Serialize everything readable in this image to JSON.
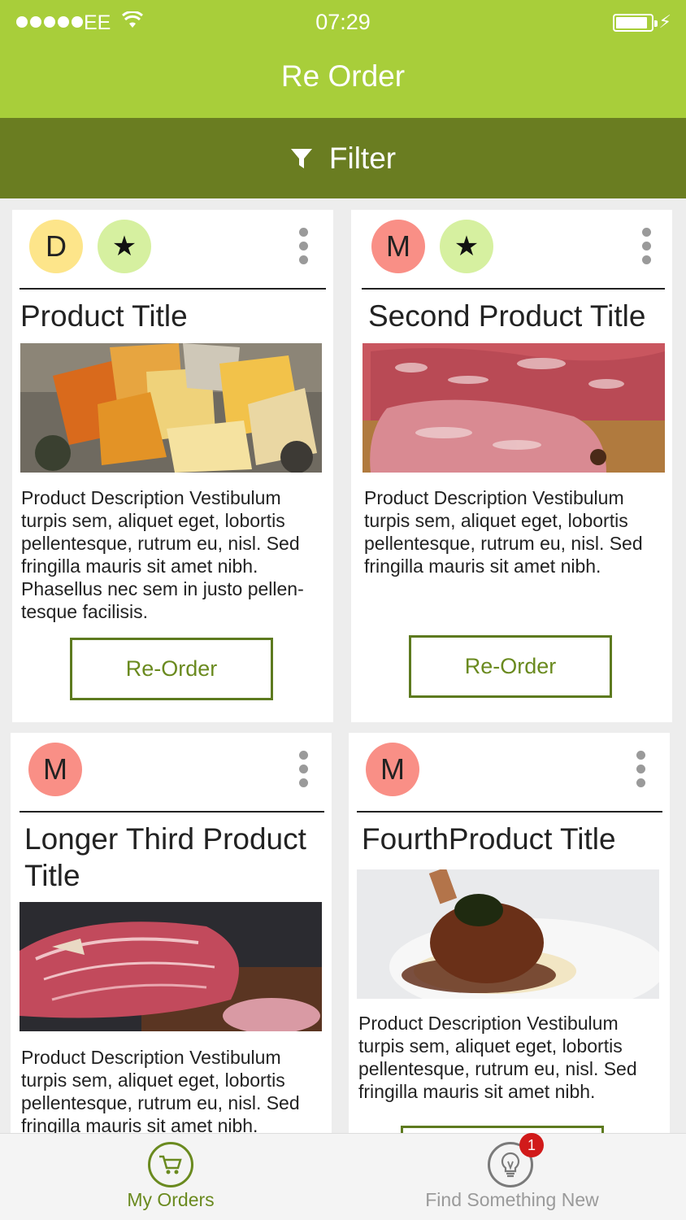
{
  "status_bar": {
    "carrier": "EE",
    "time": "07:29"
  },
  "header": {
    "title": "Re Order"
  },
  "filter": {
    "label": "Filter"
  },
  "colors": {
    "header": "#a8ce3a",
    "filter_bar": "#6a7d21",
    "accent": "#6a8a1f",
    "badge_d": "#fde58a",
    "badge_m": "#f98f86",
    "badge_star": "#d6f0a0",
    "notification": "#d11a1a"
  },
  "cards": [
    {
      "badge": "D",
      "starred": true,
      "title": "Product Title",
      "image": "cheese-platter",
      "description": "Product Description Vestibulum turpis sem, aliquet eget, lobortis pellentesque, rutrum eu, nisl. Sed fringilla mauris sit amet nibh. Phasellus nec sem in justo pellen-tesque facilisis.",
      "button": "Re-Order"
    },
    {
      "badge": "M",
      "starred": true,
      "title": "Second Product Title",
      "image": "marbled-beef",
      "description": "Product Description Vestibulum turpis sem, aliquet eget, lobortis pellentesque, rutrum eu, nisl. Sed fringilla mauris sit amet nibh.",
      "button": "Re-Order"
    },
    {
      "badge": "M",
      "starred": false,
      "title": "Longer Third Product Title",
      "image": "cured-ham",
      "description": "Product Description Vestibulum turpis sem, aliquet eget, lobortis pellentesque, rutrum eu, nisl. Sed fringilla mauris sit amet nibh.",
      "button": ""
    },
    {
      "badge": "M",
      "starred": false,
      "title": "FourthProduct Title",
      "image": "braised-lamb-shank",
      "description": "Product Description Vestibulum turpis sem, aliquet eget, lobortis pellentesque, rutrum eu, nisl. Sed fringilla mauris sit amet nibh.",
      "button": ""
    }
  ],
  "star_glyph": "★",
  "tabs": [
    {
      "label": "My Orders",
      "icon": "cart-icon",
      "active": true
    },
    {
      "label": "Find Something New",
      "icon": "lightbulb-icon",
      "active": false,
      "notification_count": "1"
    }
  ]
}
